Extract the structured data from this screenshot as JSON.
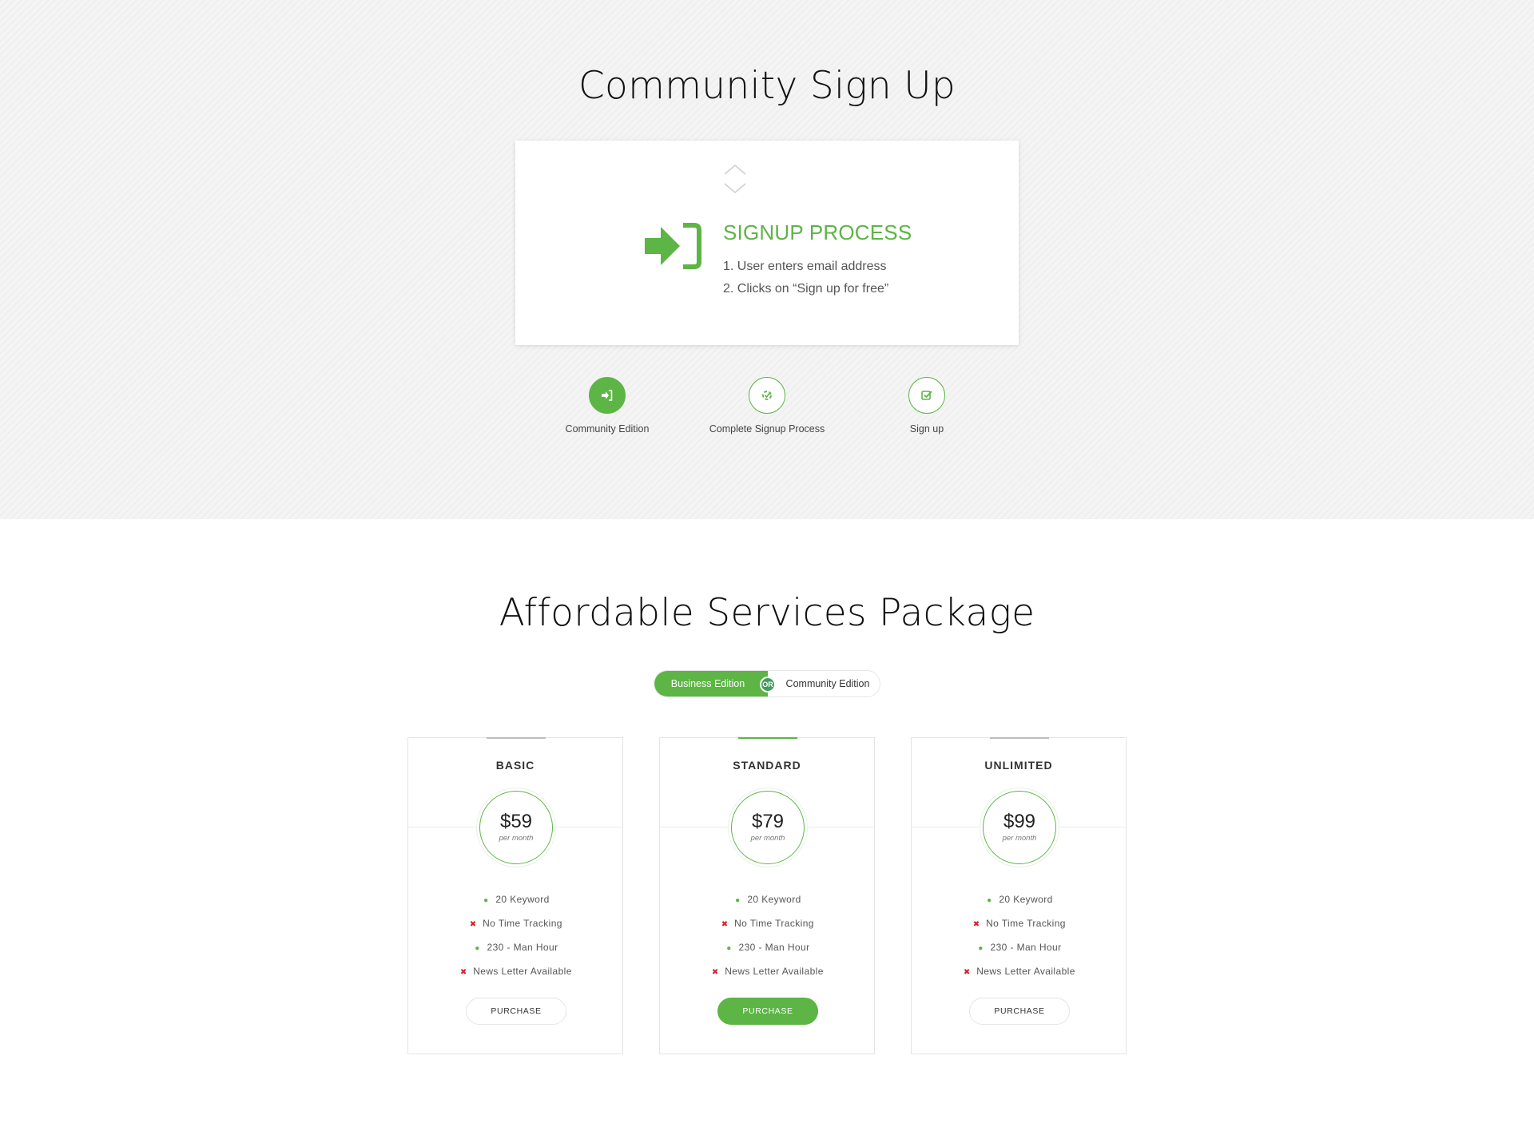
{
  "signup": {
    "title": "Community Sign Up",
    "process_card": {
      "heading": "SIGNUP PROCESS",
      "steps": [
        "1.  User enters email address",
        "2. Clicks on “Sign up for free”"
      ],
      "icon": "sign-in-arrow-icon"
    },
    "steps": [
      {
        "label": "Community Edition",
        "icon": "sign-in-icon",
        "active": true
      },
      {
        "label": "Complete Signup Process",
        "icon": "process-icon",
        "active": false
      },
      {
        "label": "Sign up",
        "icon": "check-square-icon",
        "active": false
      }
    ]
  },
  "pricing": {
    "title": "Affordable Services Package",
    "toggle": {
      "left": "Business Edition",
      "or": "OR",
      "right": "Community Edition"
    },
    "plans": [
      {
        "name": "BASIC",
        "price": "$59",
        "period": "per month",
        "featured": false,
        "features": [
          {
            "text": "20 Keyword",
            "included": true
          },
          {
            "text": "No Time Tracking",
            "included": false
          },
          {
            "text": "230 - Man Hour",
            "included": true
          },
          {
            "text": "News Letter Available",
            "included": false
          }
        ],
        "button": "PURCHASE"
      },
      {
        "name": "STANDARD",
        "price": "$79",
        "period": "per month",
        "featured": true,
        "features": [
          {
            "text": "20 Keyword",
            "included": true
          },
          {
            "text": "No Time Tracking",
            "included": false
          },
          {
            "text": "230 - Man Hour",
            "included": true
          },
          {
            "text": "News Letter Available",
            "included": false
          }
        ],
        "button": "PURCHASE"
      },
      {
        "name": "UNLIMITED",
        "price": "$99",
        "period": "per month",
        "featured": false,
        "features": [
          {
            "text": "20 Keyword",
            "included": true
          },
          {
            "text": "No Time Tracking",
            "included": false
          },
          {
            "text": "230 - Man Hour",
            "included": true
          },
          {
            "text": "News Letter Available",
            "included": false
          }
        ],
        "button": "PURCHASE"
      }
    ]
  },
  "colors": {
    "accent": "#5cb545",
    "negative": "#d0252f",
    "or_badge": "#3f9d5f"
  }
}
